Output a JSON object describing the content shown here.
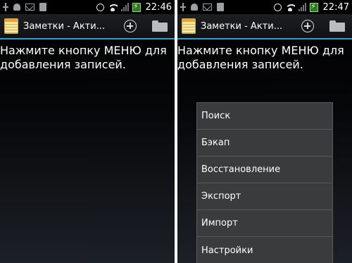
{
  "left_screen": {
    "status_bar": {
      "time": "22:46"
    },
    "action_bar": {
      "title": "Заметки - Акти..."
    },
    "hint": "Нажмите кнопку МЕНЮ для добавления записей."
  },
  "right_screen": {
    "status_bar": {
      "time": "22:47"
    },
    "action_bar": {
      "title": "Заметки - Акти..."
    },
    "hint": "Нажмите кнопку МЕНЮ для добавления записей.",
    "menu": {
      "items": [
        {
          "label": "Поиск"
        },
        {
          "label": "Бэкап"
        },
        {
          "label": "Восстановление"
        },
        {
          "label": "Экспорт"
        },
        {
          "label": "Импорт"
        },
        {
          "label": "Настройки"
        }
      ]
    }
  },
  "colors": {
    "accent": "#2f9ed8",
    "menu_bg": "#3a3b3d",
    "battery": "#2a7a1e"
  }
}
